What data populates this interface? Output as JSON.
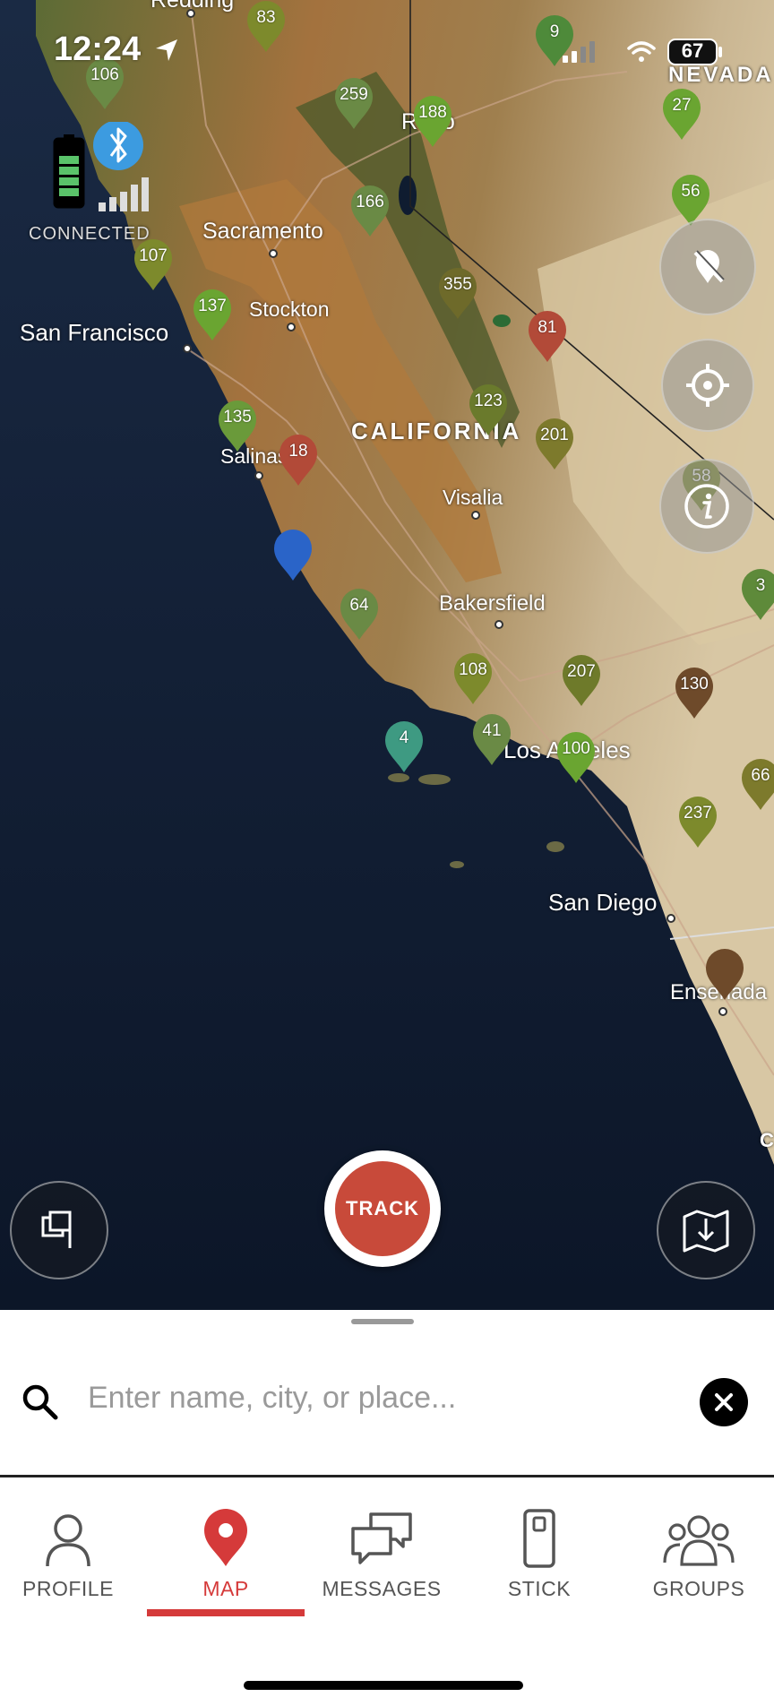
{
  "status_bar": {
    "time": "12:24",
    "battery": "67"
  },
  "device": {
    "connection_status": "CONNECTED"
  },
  "map": {
    "places": {
      "reading": "Redding",
      "nevada": "NEVADA",
      "sacramento": "Sacramento",
      "reno": "Reno",
      "stockton": "Stockton",
      "san_francisco": "San Francisco",
      "california": "CALIFORNIA",
      "salinas": "Salinas",
      "visalia": "Visalia",
      "bakersfield": "Bakersfield",
      "los_angeles": "Los Angeles",
      "san_diego": "San Diego",
      "ensenada": "Ensenada",
      "c": "C"
    },
    "markers": {
      "m83": "83",
      "m106": "106",
      "m259": "259",
      "m188": "188",
      "m9": "9",
      "m27": "27",
      "m166": "166",
      "m56": "56",
      "m107": "107",
      "m355": "355",
      "m137": "137",
      "m81": "81",
      "m135": "135",
      "m123": "123",
      "m201": "201",
      "m18": "18",
      "m58": "58",
      "m64": "64",
      "m3": "3",
      "m108": "108",
      "m207": "207",
      "m130": "130",
      "m4": "4",
      "m41": "41",
      "m100": "100",
      "m66": "66",
      "m237": "237"
    },
    "marker_colors": {
      "green": "#6aa531",
      "olive": "#7d8a2c",
      "red": "#b24a38",
      "brown": "#6e4a2a",
      "teal": "#3e9a82",
      "blue": "#2a64c8"
    }
  },
  "controls": {
    "track_label": "TRACK"
  },
  "search": {
    "placeholder": "Enter name, city, or place...",
    "value": ""
  },
  "tabs": [
    {
      "label": "PROFILE"
    },
    {
      "label": "MAP"
    },
    {
      "label": "MESSAGES"
    },
    {
      "label": "STICK"
    },
    {
      "label": "GROUPS"
    }
  ],
  "accent_color": "#d53a3a"
}
